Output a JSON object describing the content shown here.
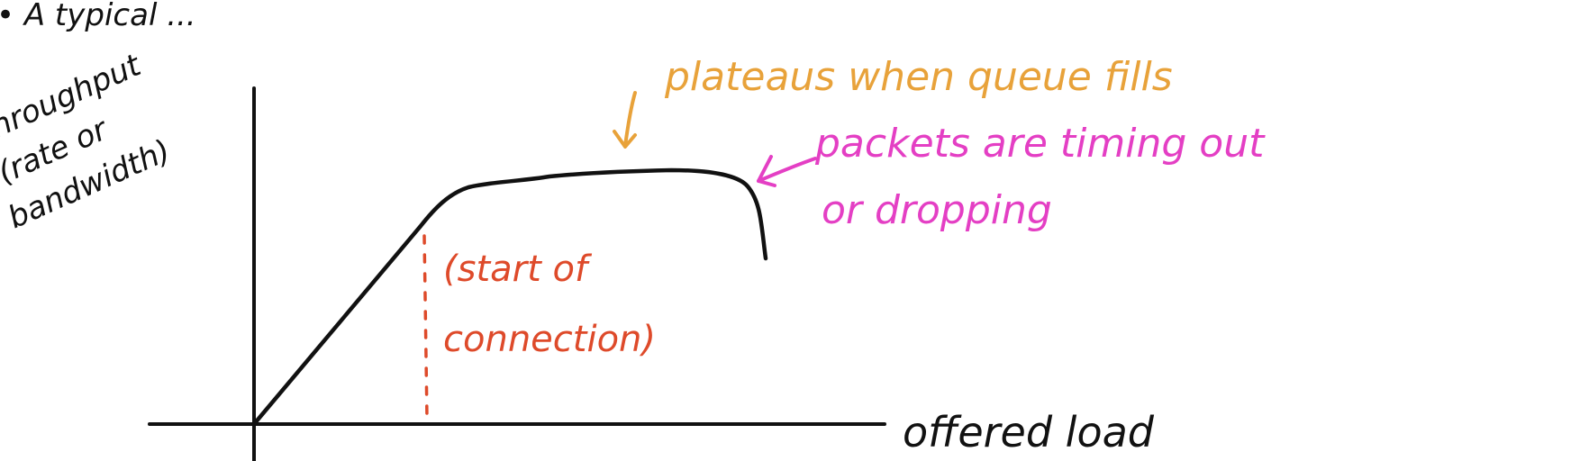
{
  "title_fragment": "• A typical ...",
  "y_axis_label": {
    "line1": "throughput",
    "line2": "(rate or",
    "line3": "bandwidth)"
  },
  "x_axis_label": "offered load",
  "annotations": {
    "plateau": "plateaus when queue fills",
    "timeout_line1": "packets are timing out",
    "timeout_line2": "or dropping",
    "start_line1": "(start of",
    "start_line2": "connection)"
  },
  "colors": {
    "ink": "#111111",
    "orange": "#e8a23a",
    "magenta": "#e43fc4",
    "red": "#de4a2a"
  }
}
